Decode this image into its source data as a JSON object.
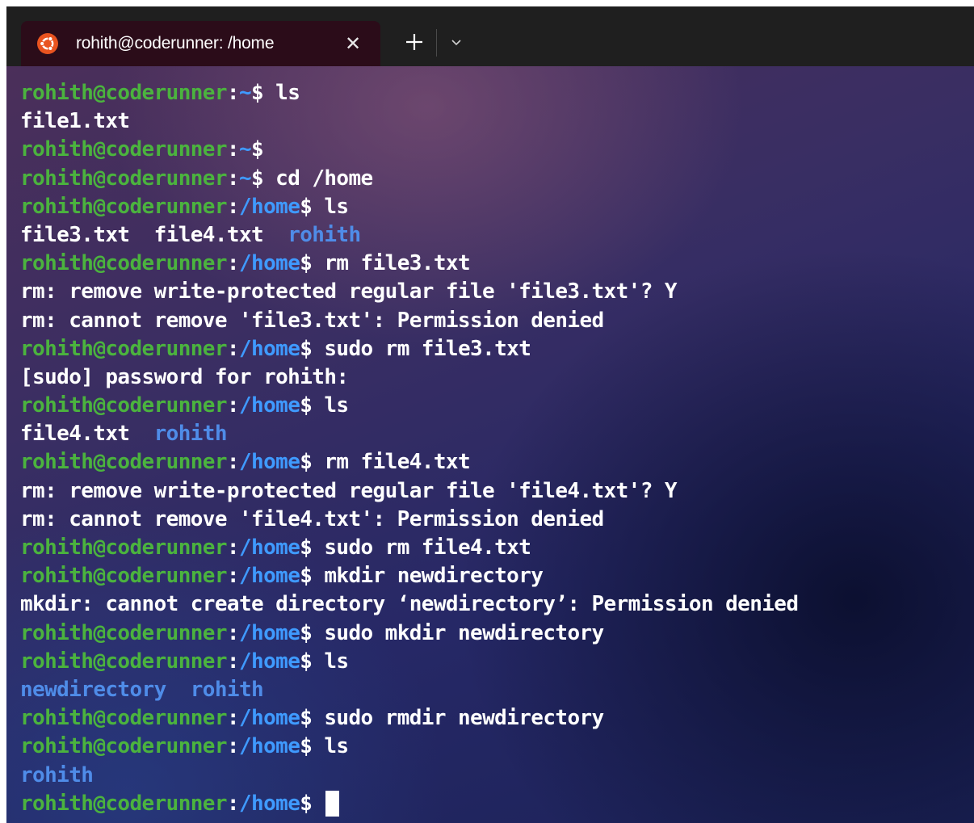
{
  "window": {
    "tab": {
      "icon": "ubuntu-icon",
      "title": "rohith@coderunner: /home",
      "close_glyph": "✕"
    },
    "new_tab_icon": "plus-icon",
    "dropdown_icon": "chevron-down-icon"
  },
  "colors": {
    "prompt_user": "#4bb33e",
    "prompt_path": "#3f9aff",
    "directory": "#4f8ce8",
    "text": "#ffffff",
    "tab_active": "#2b0c19",
    "ubuntu_orange": "#e95420"
  },
  "prompt": {
    "user": "rohith@coderunner",
    "colon": ":",
    "dollar": "$ "
  },
  "terminal": {
    "lines": [
      {
        "type": "prompt",
        "path": "~",
        "cmd": "ls"
      },
      {
        "type": "out",
        "text": "file1.txt"
      },
      {
        "type": "prompt",
        "path": "~",
        "cmd": ""
      },
      {
        "type": "prompt",
        "path": "~",
        "cmd": "cd /home"
      },
      {
        "type": "prompt",
        "path": "/home",
        "cmd": "ls"
      },
      {
        "type": "ls",
        "items": [
          {
            "text": "file3.txt",
            "dir": false
          },
          {
            "text": "file4.txt",
            "dir": false
          },
          {
            "text": "rohith",
            "dir": true
          }
        ]
      },
      {
        "type": "prompt",
        "path": "/home",
        "cmd": "rm file3.txt"
      },
      {
        "type": "out",
        "text": "rm: remove write-protected regular file 'file3.txt'? Y"
      },
      {
        "type": "out",
        "text": "rm: cannot remove 'file3.txt': Permission denied"
      },
      {
        "type": "prompt",
        "path": "/home",
        "cmd": "sudo rm file3.txt"
      },
      {
        "type": "out",
        "text": "[sudo] password for rohith:"
      },
      {
        "type": "prompt",
        "path": "/home",
        "cmd": "ls"
      },
      {
        "type": "ls",
        "items": [
          {
            "text": "file4.txt",
            "dir": false
          },
          {
            "text": "rohith",
            "dir": true
          }
        ]
      },
      {
        "type": "prompt",
        "path": "/home",
        "cmd": "rm file4.txt"
      },
      {
        "type": "out",
        "text": "rm: remove write-protected regular file 'file4.txt'? Y"
      },
      {
        "type": "out",
        "text": "rm: cannot remove 'file4.txt': Permission denied"
      },
      {
        "type": "prompt",
        "path": "/home",
        "cmd": "sudo rm file4.txt"
      },
      {
        "type": "prompt",
        "path": "/home",
        "cmd": "mkdir newdirectory"
      },
      {
        "type": "out",
        "text": "mkdir: cannot create directory ‘newdirectory’: Permission denied"
      },
      {
        "type": "prompt",
        "path": "/home",
        "cmd": "sudo mkdir newdirectory"
      },
      {
        "type": "prompt",
        "path": "/home",
        "cmd": "ls"
      },
      {
        "type": "ls",
        "items": [
          {
            "text": "newdirectory",
            "dir": true
          },
          {
            "text": "rohith",
            "dir": true
          }
        ]
      },
      {
        "type": "prompt",
        "path": "/home",
        "cmd": "sudo rmdir newdirectory"
      },
      {
        "type": "prompt",
        "path": "/home",
        "cmd": "ls"
      },
      {
        "type": "ls",
        "items": [
          {
            "text": "rohith",
            "dir": true
          }
        ]
      },
      {
        "type": "prompt",
        "path": "/home",
        "cmd": "",
        "cursor": true
      }
    ]
  }
}
